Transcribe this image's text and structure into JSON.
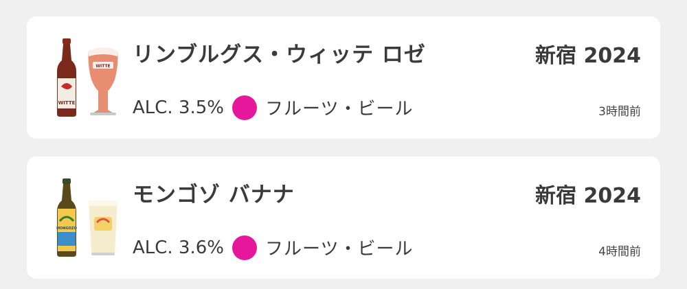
{
  "accent_color": "#e5189b",
  "checkins": [
    {
      "beer_name": "リンブルグス・ウィッテ ロゼ",
      "event": "新宿 2024",
      "abv": "ALC. 3.5%",
      "style": "フルーツ・ビール",
      "style_color": "#e5189b",
      "time_ago": "3時間前",
      "thumb_icon": "beer-bottle-and-glass-icon",
      "thumb_label": "WITTE"
    },
    {
      "beer_name": "モンゴゾ バナナ",
      "event": "新宿 2024",
      "abv": "ALC. 3.6%",
      "style": "フルーツ・ビール",
      "style_color": "#e5189b",
      "time_ago": "4時間前",
      "thumb_icon": "beer-bottle-and-glass-icon",
      "thumb_label": "MONGOZO"
    }
  ]
}
